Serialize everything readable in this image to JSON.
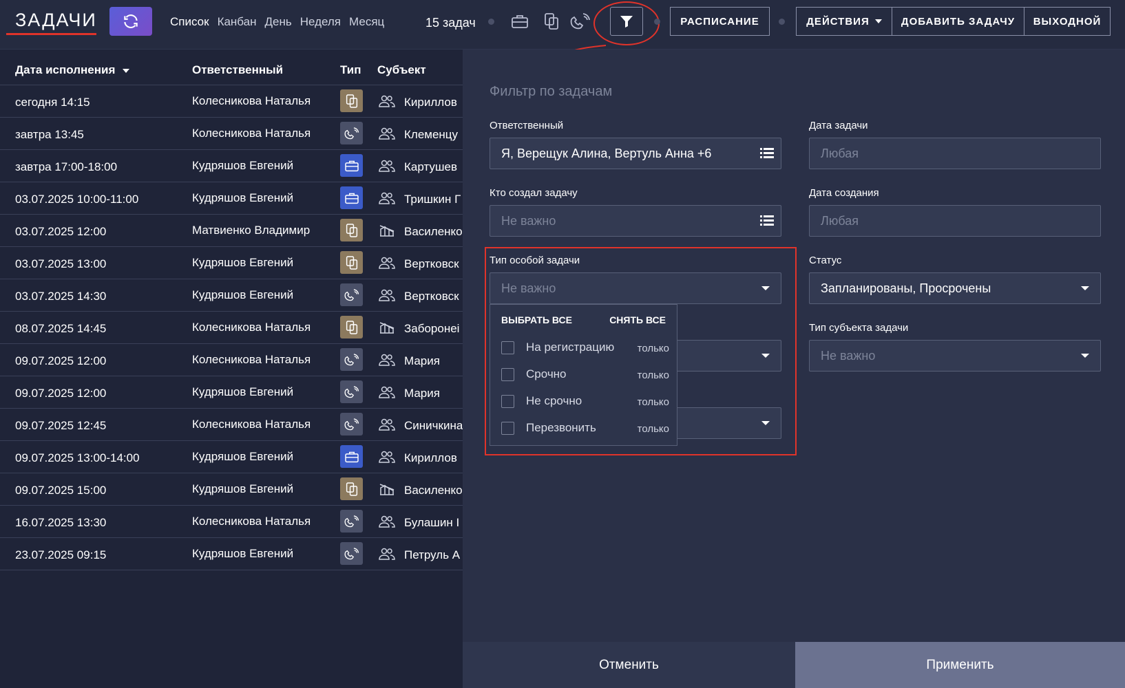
{
  "header": {
    "title": "ЗАДАЧИ",
    "view_tabs": [
      "Список",
      "Канбан",
      "День",
      "Неделя",
      "Месяц"
    ],
    "count": "15 задач",
    "buttons": {
      "schedule": "РАСПИСАНИЕ",
      "actions": "ДЕЙСТВИЯ",
      "add_task": "ДОБАВИТЬ ЗАДАЧУ",
      "day_off": "ВЫХОДНОЙ"
    }
  },
  "table": {
    "columns": [
      "Дата исполнения",
      "Ответственный",
      "Тип",
      "Субъект"
    ],
    "rows": [
      {
        "date": "сегодня 14:15",
        "resp": "Колесникова Наталья",
        "type": "copy-icon",
        "subject_icon": "people-icon",
        "subject": "Кириллов"
      },
      {
        "date": "завтра 13:45",
        "resp": "Колесникова Наталья",
        "type": "phone-icon",
        "subject_icon": "people-icon",
        "subject": "Клеменцу"
      },
      {
        "date": "завтра 17:00-18:00",
        "resp": "Кудряшов Евгений",
        "type": "briefcase-icon",
        "subject_icon": "people-icon",
        "subject": "Картушев"
      },
      {
        "date": "03.07.2025 10:00-11:00",
        "resp": "Кудряшов Евгений",
        "type": "briefcase-icon",
        "subject_icon": "people-icon",
        "subject": "Тришкин Г"
      },
      {
        "date": "03.07.2025 12:00",
        "resp": "Матвиенко Владимир",
        "type": "copy-icon",
        "subject_icon": "building-icon",
        "subject": "Василенко"
      },
      {
        "date": "03.07.2025 13:00",
        "resp": "Кудряшов Евгений",
        "type": "copy-icon",
        "subject_icon": "people-icon",
        "subject": "Вертковск"
      },
      {
        "date": "03.07.2025 14:30",
        "resp": "Кудряшов Евгений",
        "type": "phone-icon",
        "subject_icon": "people-icon",
        "subject": "Вертковск"
      },
      {
        "date": "08.07.2025 14:45",
        "resp": "Колесникова Наталья",
        "type": "copy-icon",
        "subject_icon": "building-icon",
        "subject": "Заборонеi"
      },
      {
        "date": "09.07.2025 12:00",
        "resp": "Колесникова Наталья",
        "type": "phone-icon",
        "subject_icon": "people-icon",
        "subject": "Мария"
      },
      {
        "date": "09.07.2025 12:00",
        "resp": "Кудряшов Евгений",
        "type": "phone-icon",
        "subject_icon": "people-icon",
        "subject": "Мария"
      },
      {
        "date": "09.07.2025 12:45",
        "resp": "Колесникова Наталья",
        "type": "phone-icon",
        "subject_icon": "people-icon",
        "subject": "Синичкина"
      },
      {
        "date": "09.07.2025 13:00-14:00",
        "resp": "Кудряшов Евгений",
        "type": "briefcase-icon",
        "subject_icon": "people-icon",
        "subject": "Кириллов"
      },
      {
        "date": "09.07.2025 15:00",
        "resp": "Кудряшов Евгений",
        "type": "copy-icon",
        "subject_icon": "building-icon",
        "subject": "Василенко"
      },
      {
        "date": "16.07.2025 13:30",
        "resp": "Колесникова Наталья",
        "type": "phone-icon",
        "subject_icon": "people-icon",
        "subject": "Булашин I"
      },
      {
        "date": "23.07.2025 09:15",
        "resp": "Кудряшов Евгений",
        "type": "phone-icon",
        "subject_icon": "people-icon",
        "subject": "Петруль А"
      }
    ]
  },
  "filter": {
    "title": "Фильтр по задачам",
    "responsible_label": "Ответственный",
    "responsible_value": "Я, Верещук Алина, Вертуль Анна +6",
    "task_date_label": "Дата задачи",
    "task_date_value": "Любая",
    "creator_label": "Кто создал задачу",
    "creator_value": "Не важно",
    "created_date_label": "Дата создания",
    "created_date_value": "Любая",
    "special_type_label": "Тип особой задачи",
    "special_type_value": "Не важно",
    "status_label": "Статус",
    "status_value": "Запланированы, Просрочены",
    "subject_type_label": "Тип субъекта задачи",
    "subject_type_value": "Не важно",
    "dropdown": {
      "select_all": "ВЫБРАТЬ ВСЕ",
      "clear_all": "СНЯТЬ ВСЕ",
      "only_label": "только",
      "items": [
        "На регистрацию",
        "Срочно",
        "Не срочно",
        "Перезвонить"
      ]
    },
    "cancel": "Отменить",
    "apply": "Применить"
  },
  "colors": {
    "accent_red": "#e0332a",
    "type_copy": "#8c7a5e",
    "type_phone": "#4a5068",
    "type_briefcase": "#3b5bc8"
  }
}
